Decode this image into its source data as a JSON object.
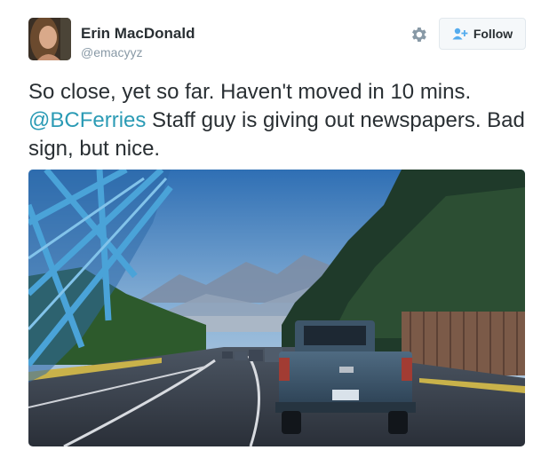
{
  "author": {
    "name": "Erin MacDonald",
    "handle": "@emacyyz"
  },
  "actions": {
    "follow_label": "Follow"
  },
  "tweet": {
    "text_before": "So close, yet so far. Haven't moved in 10 mins. ",
    "mention": "@BCFerries",
    "text_after": " Staff guy is giving out newspapers. Bad sign, but nice."
  },
  "colors": {
    "mention": "#2b9bb5",
    "text": "#292f33",
    "handle": "#8899a6"
  },
  "icons": {
    "settings": "gear-icon",
    "follow": "person-add-icon"
  }
}
